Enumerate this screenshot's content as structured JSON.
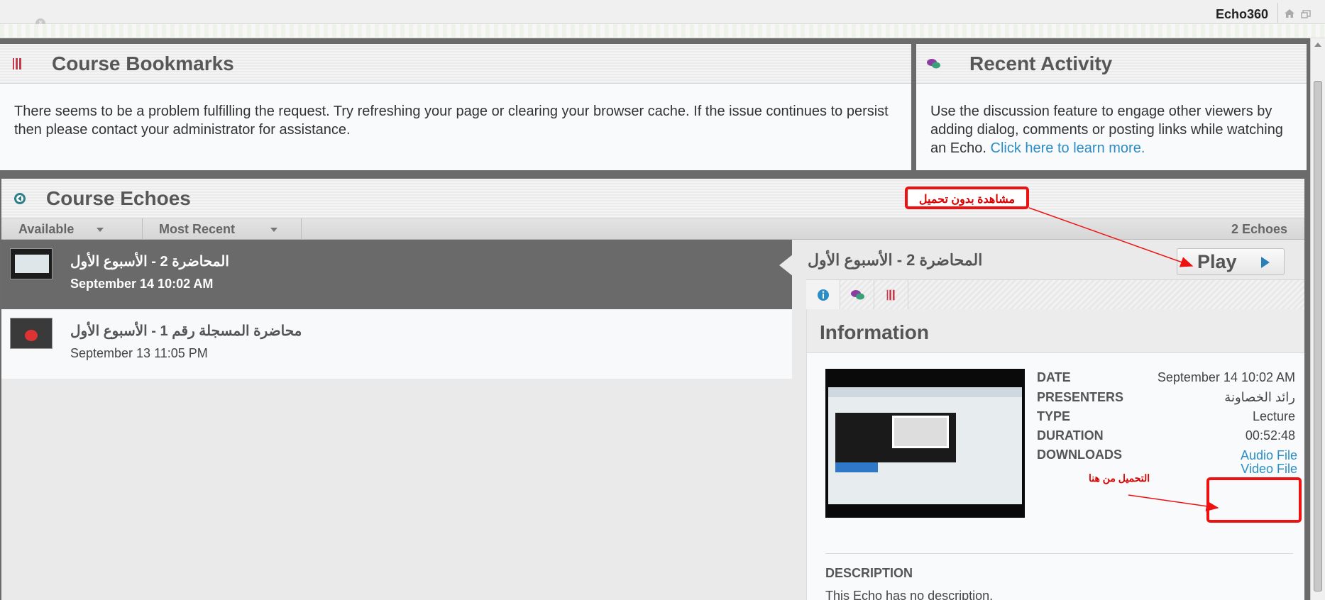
{
  "header": {
    "brand": "Echo360",
    "close_glyph": "×"
  },
  "bookmarks": {
    "title": "Course Bookmarks",
    "message": "There seems to be a problem fulfilling the request. Try refreshing your page or clearing your browser cache. If the issue continues to persist then please contact your administrator for assistance."
  },
  "activity": {
    "title": "Recent Activity",
    "message": "Use the discussion feature to engage other viewers by adding dialog, comments or posting links while watching an Echo.",
    "link": "Click here to learn more."
  },
  "echoes": {
    "title": "Course Echoes",
    "filter_available": "Available",
    "filter_sort": "Most Recent",
    "count": "2 Echoes",
    "items": [
      {
        "title": "المحاضرة 2 - الأسبوع الأول",
        "date": "September 14 10:02 AM"
      },
      {
        "title": "محاضرة المسجلة رقم 1 - الأسبوع الأول",
        "date": "September 13 11:05 PM"
      }
    ]
  },
  "detail": {
    "title": "المحاضرة 2 - الأسبوع الأول",
    "play_label": "Play",
    "tabs": [
      "info-icon",
      "discussion-icon",
      "bookmark-icon"
    ],
    "info_heading": "Information",
    "fields": {
      "date_label": "DATE",
      "date_value": "September 14 10:02 AM",
      "presenters_label": "PRESENTERS",
      "presenters_value": "رائد الخصاونة",
      "type_label": "TYPE",
      "type_value": "Lecture",
      "duration_label": "DURATION",
      "duration_value": "00:52:48",
      "downloads_label": "DOWNLOADS"
    },
    "downloads": [
      "Audio File",
      "Video File"
    ],
    "description_heading": "DESCRIPTION",
    "description": "This Echo has no description."
  },
  "annotations": {
    "watch_no_download": "مشاهدة بدون تحميل",
    "download_from_here": "التحميل من هنا",
    "color": "#e11111"
  },
  "colors": {
    "accent_link": "#2b8dc6",
    "active_row": "#6a6a6a",
    "frame": "#6b6b6b"
  }
}
